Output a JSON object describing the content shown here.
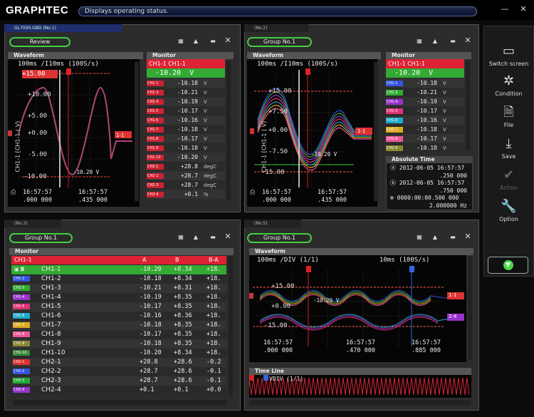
{
  "app": {
    "logo": "GRAPHTEC",
    "status": "Displays operating status."
  },
  "window_controls": {
    "minimize": "—",
    "close": "✕"
  },
  "right_panel": {
    "items": [
      {
        "name": "switch-screen",
        "label": "Switch screen",
        "icon": "monitor-icon",
        "glyph": "▭"
      },
      {
        "name": "condition",
        "label": "Condition",
        "icon": "gear-icon",
        "glyph": "✲"
      },
      {
        "name": "file",
        "label": "File",
        "icon": "file-icon",
        "glyph": "🗎"
      },
      {
        "name": "save",
        "label": "Save",
        "icon": "save-icon",
        "glyph": "⤓"
      },
      {
        "name": "action",
        "label": "Action",
        "icon": "check-icon",
        "glyph": "✔"
      },
      {
        "name": "option",
        "label": "Option",
        "icon": "wrench-icon",
        "glyph": "🔧"
      }
    ]
  },
  "pane1": {
    "tab": "GL7000.GBD (No.1)",
    "group": "Review",
    "waveform_title": "Waveform",
    "monitor_title": "Monitor",
    "timebase": "100ms /I10ms (100S/s)",
    "top_value": "+15.00",
    "yticks": [
      "+10.00",
      "+5.00",
      "+0.00",
      "-5.00",
      "-10.00"
    ],
    "ylabel": "CH1-1 [CH1-1 ( V)",
    "marker_value": "-10.20 V",
    "ch_tag": "1-1",
    "time_left": "16:57:57",
    "time_left2": ".000 000",
    "time_right": "16:57:57",
    "time_right2": ".435 000",
    "monitor_head": "CH1-1 CH1-1",
    "monitor_value": "-10.20",
    "monitor_unit": "V",
    "rows": [
      {
        "ch": "CH1-1",
        "val": "-10.18",
        "unit": "V",
        "color": "#c23"
      },
      {
        "ch": "CH1-3",
        "val": "-10.21",
        "unit": "V",
        "color": "#c23"
      },
      {
        "ch": "CH1-4",
        "val": "-10.19",
        "unit": "V",
        "color": "#c23"
      },
      {
        "ch": "CH1-5",
        "val": "-10.17",
        "unit": "V",
        "color": "#c23"
      },
      {
        "ch": "CH1-6",
        "val": "-10.16",
        "unit": "V",
        "color": "#c23"
      },
      {
        "ch": "CH1-7",
        "val": "-10.18",
        "unit": "V",
        "color": "#c23"
      },
      {
        "ch": "CH1-8",
        "val": "-10.17",
        "unit": "V",
        "color": "#c23"
      },
      {
        "ch": "CH1-9",
        "val": "-10.18",
        "unit": "V",
        "color": "#c23"
      },
      {
        "ch": "CH1-10",
        "val": "-10.20",
        "unit": "V",
        "color": "#c23"
      },
      {
        "ch": "CH2-1",
        "val": "+28.8",
        "unit": "degC",
        "color": "#c23"
      },
      {
        "ch": "CH2-2",
        "val": "+28.7",
        "unit": "degC",
        "color": "#c23"
      },
      {
        "ch": "CH2-3",
        "val": "+28.7",
        "unit": "degC",
        "color": "#c23"
      },
      {
        "ch": "CH2-4",
        "val": "+0.1",
        "unit": "%",
        "color": "#c23"
      }
    ]
  },
  "pane2": {
    "tab": "(No.2)",
    "group": "Group No.1",
    "waveform_title": "Waveform",
    "monitor_title": "Monitor",
    "timebase": "100ms /I10ms (100S/s)",
    "yticks": [
      "+15.00",
      "+7.50",
      "+0.00",
      "-7.50",
      "-15.00"
    ],
    "ylabel": "CH1-1 [CH1-1 ( V)",
    "marker_value": "-10.20 V",
    "ch_tag": "1-1",
    "time_left": "16:57:57",
    "time_left2": ".000 000",
    "time_right": "16:57:57",
    "time_right2": ".435 000",
    "monitor_head": "CH1-1 CH1-1",
    "monitor_value": "-10.20",
    "monitor_unit": "V",
    "rows": [
      {
        "ch": "CH1-1",
        "val": "-10.18",
        "unit": "V",
        "color": "#3355dd"
      },
      {
        "ch": "CH1-3",
        "val": "-10.21",
        "unit": "V",
        "color": "#33aa33"
      },
      {
        "ch": "CH1-4",
        "val": "-10.19",
        "unit": "V",
        "color": "#9933cc"
      },
      {
        "ch": "CH1-5",
        "val": "-10.17",
        "unit": "V",
        "color": "#dd3377"
      },
      {
        "ch": "CH1-6",
        "val": "-10.16",
        "unit": "V",
        "color": "#22aacc"
      },
      {
        "ch": "CH1-7",
        "val": "-10.18",
        "unit": "V",
        "color": "#ddaa22"
      },
      {
        "ch": "CH1-8",
        "val": "-10.17",
        "unit": "V",
        "color": "#ee5599"
      },
      {
        "ch": "CH1-9",
        "val": "-10.18",
        "unit": "V",
        "color": "#888833"
      }
    ],
    "abs_title": "Absolute Time",
    "abs_a_date": "2012-06-05 16:57:57",
    "abs_a_frac": ".250 000",
    "abs_b_date": "2012-06-05 16:57:57",
    "abs_b_frac": ".750 000",
    "abs_diff": "0000:00:00.500 000",
    "abs_hz": "2.000000 Hz"
  },
  "pane3": {
    "tab": "(No.3)",
    "group": "Group No.1",
    "monitor_title": "Monitor",
    "head": {
      "ch": "CH1-1",
      "a": "A",
      "b": "B",
      "ba": "B-A"
    },
    "rows": [
      {
        "chip": "",
        "ch": "CH1-1",
        "a": "-10.20",
        "b": "+8.34",
        "ba": "+18.",
        "color": "#3a3",
        "sel": true
      },
      {
        "chip": "CH1-2",
        "ch": "CH1-2",
        "a": "-10.18",
        "b": "+8.34",
        "ba": "+18.",
        "color": "#3355dd"
      },
      {
        "chip": "CH1-3",
        "ch": "CH1-3",
        "a": "-10.21",
        "b": "+8.31",
        "ba": "+18.",
        "color": "#33aa33"
      },
      {
        "chip": "CH1-4",
        "ch": "CH1-4",
        "a": "-10.19",
        "b": "+8.35",
        "ba": "+18.",
        "color": "#9933cc"
      },
      {
        "chip": "CH1-5",
        "ch": "CH1-5",
        "a": "-10.17",
        "b": "+8.35",
        "ba": "+18.",
        "color": "#dd3377"
      },
      {
        "chip": "CH1-6",
        "ch": "CH1-6",
        "a": "-10.16",
        "b": "+8.36",
        "ba": "+18.",
        "color": "#22aacc"
      },
      {
        "chip": "CH1-7",
        "ch": "CH1-7",
        "a": "-10.18",
        "b": "+8.35",
        "ba": "+18.",
        "color": "#ddaa22"
      },
      {
        "chip": "CH1-8",
        "ch": "CH1-8",
        "a": "-10.17",
        "b": "+8.35",
        "ba": "+18.",
        "color": "#ee5599"
      },
      {
        "chip": "CH1-9",
        "ch": "CH1-9",
        "a": "-10.18",
        "b": "+8.35",
        "ba": "+18.",
        "color": "#888833"
      },
      {
        "chip": "CH1-10",
        "ch": "CH1-10",
        "a": "-10.20",
        "b": "+8.34",
        "ba": "+18.",
        "color": "#3a8a3a"
      },
      {
        "chip": "CH2-1",
        "ch": "CH2-1",
        "a": "+28.8",
        "b": "+28.6",
        "ba": "-0.2",
        "color": "#dd3333"
      },
      {
        "chip": "CH2-2",
        "ch": "CH2-2",
        "a": "+28.7",
        "b": "+28.6",
        "ba": "-0.1",
        "color": "#3355dd"
      },
      {
        "chip": "CH2-3",
        "ch": "CH2-3",
        "a": "+28.7",
        "b": "+28.6",
        "ba": "-0.1",
        "color": "#22aa33"
      },
      {
        "chip": "CH2-4",
        "ch": "CH2-4",
        "a": "+0.1",
        "b": "+0.1",
        "ba": "+0.0",
        "color": "#9933cc"
      }
    ]
  },
  "pane4": {
    "tab": "(No.5)",
    "group": "Group No.1",
    "waveform_title": "Waveform",
    "timeline_title": "Time Line",
    "timebase_left": "100ms /DIV (1/1)",
    "timebase_right": "10ms (100S/s)",
    "yticks": [
      "+15.00",
      "+0.00",
      "-15.00"
    ],
    "marker_value": "-10.20 V",
    "tag1": "1-1",
    "tag2": "2-4",
    "time_left": "16:57:57",
    "time_left2": ".000 000",
    "time_mid": "16:57:57",
    "time_mid2": ".470 000",
    "time_right": "16:57:57",
    "time_right2": ".885 000",
    "timeline_label": "VDIV (1/1)"
  }
}
